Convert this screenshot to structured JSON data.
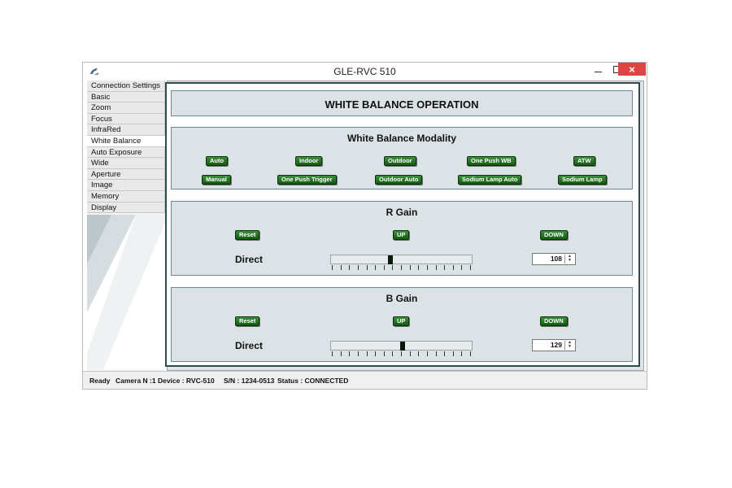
{
  "window": {
    "title": "GLE-RVC 510",
    "close_glyph": "×",
    "app_icon": "app-logo-icon"
  },
  "sidebar": {
    "items": [
      {
        "label": "Connection Settings",
        "active": false
      },
      {
        "label": "Basic",
        "active": false
      },
      {
        "label": "Zoom",
        "active": false
      },
      {
        "label": "Focus",
        "active": false
      },
      {
        "label": "InfraRed",
        "active": false
      },
      {
        "label": "White Balance",
        "active": true
      },
      {
        "label": "Auto Exposure",
        "active": false
      },
      {
        "label": "Wide",
        "active": false
      },
      {
        "label": "Aperture",
        "active": false
      },
      {
        "label": "Image",
        "active": false
      },
      {
        "label": "Memory",
        "active": false
      },
      {
        "label": "Display",
        "active": false
      }
    ]
  },
  "main": {
    "title": "WHITE BALANCE OPERATION",
    "modality": {
      "title": "White Balance Modality",
      "row1": [
        "Auto",
        "Indoor",
        "Outdoor",
        "One Push WB",
        "ATW"
      ],
      "row2": [
        "Manual",
        "One Push Trigger",
        "Outdoor Auto",
        "Sodium Lamp Auto",
        "Sodium Lamp"
      ]
    },
    "r_gain": {
      "title": "R Gain",
      "reset_label": "Reset",
      "up_label": "UP",
      "down_label": "DOWN",
      "direct_label": "Direct",
      "value": "108",
      "slider_fraction": 0.42
    },
    "b_gain": {
      "title": "B Gain",
      "reset_label": "Reset",
      "up_label": "UP",
      "down_label": "DOWN",
      "direct_label": "Direct",
      "value": "129",
      "slider_fraction": 0.51
    }
  },
  "status": {
    "ready": "Ready",
    "camera": "Camera N :1 Device : RVC-510",
    "serial": "S/N : 1234-0513",
    "state": "Status : CONNECTED"
  },
  "colors": {
    "button_green": "#135a13",
    "panel_bg": "#dce3e6",
    "close_red": "#e04343"
  }
}
